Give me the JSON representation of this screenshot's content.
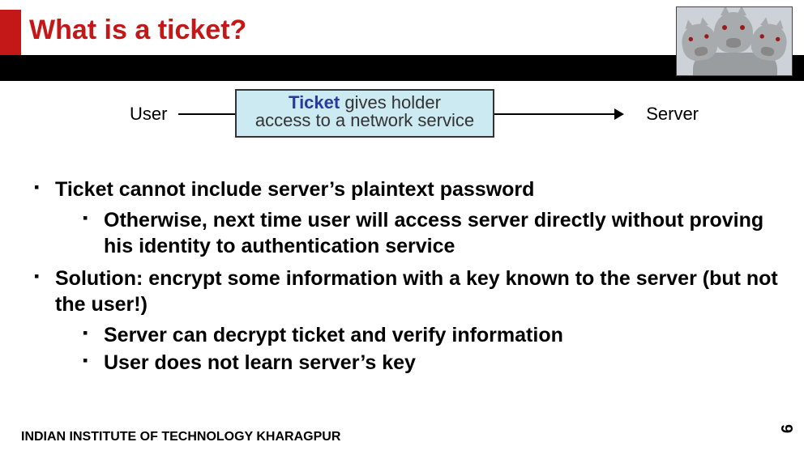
{
  "title": "What is a ticket?",
  "diagram": {
    "user": "User",
    "server": "Server",
    "ticket_word": "Ticket",
    "line1_rest": " gives holder",
    "line2": "access to a network service"
  },
  "bullets": {
    "b1": "Ticket cannot include server’s plaintext password",
    "b1a": "Otherwise, next time user will access server directly without proving his identity to authentication service",
    "b2": "Solution: encrypt some information with a key known to the server (but not the user!)",
    "b2a": "Server can decrypt ticket and verify information",
    "b2b": "User does not learn server’s key"
  },
  "footer": "INDIAN INSTITUTE OF TECHNOLOGY KHARAGPUR",
  "page_number": "6",
  "logo_alt": "cerberus-image"
}
